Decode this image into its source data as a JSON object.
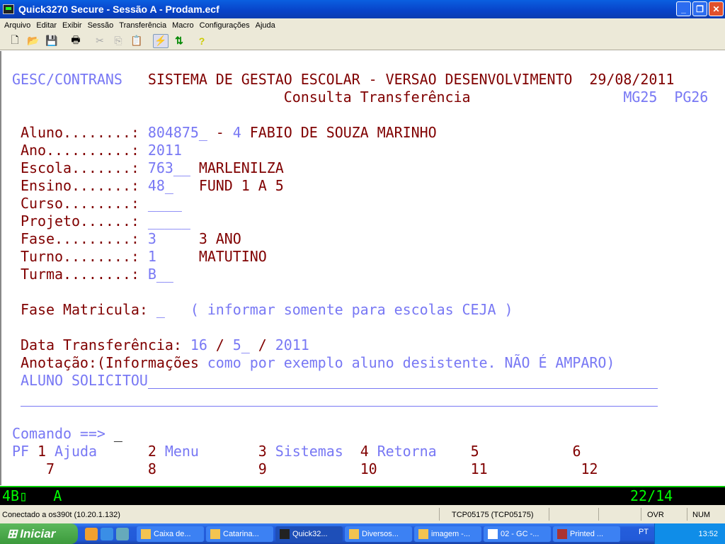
{
  "window": {
    "title": "Quick3270 Secure - Sessão A - Prodam.ecf"
  },
  "menu": [
    "Arquivo",
    "Editar",
    "Exibir",
    "Sessão",
    "Transferência",
    "Macro",
    "Configurações",
    "Ajuda"
  ],
  "toolbar": {
    "icons": [
      "new-icon",
      "open-icon",
      "save-icon",
      "print-icon",
      "cut-icon",
      "copy-icon",
      "paste-icon",
      "connect-icon",
      "transfer-icon",
      "help-icon"
    ]
  },
  "colors": {
    "field": "#7878f4",
    "label": "#800000",
    "oia": "#00ff00"
  },
  "screen": {
    "system": "GESC/CONTRANS",
    "heading": "SISTEMA DE GESTAO ESCOLAR - VERSAO DESENVOLVIMENTO",
    "date": "29/08/2011",
    "subtitle": "Consulta Transferência",
    "map": "MG25",
    "program": "PG26",
    "fields": [
      {
        "label": "Aluno........: ",
        "value": "804875_",
        "sep": " - ",
        "digit": "4",
        "desc": " FABIO DE SOUZA MARINHO"
      },
      {
        "label": "Ano..........: ",
        "value": "2011"
      },
      {
        "label": "Escola.......: ",
        "value": "763__ ",
        "desc": "MARLENILZA"
      },
      {
        "label": "Ensino.......: ",
        "value": "48_   ",
        "desc": "FUND 1 A 5"
      },
      {
        "label": "Curso........: ",
        "value": "____"
      },
      {
        "label": "Projeto......: ",
        "value": "_____"
      },
      {
        "label": "Fase.........: ",
        "value": "3     ",
        "desc": "3 ANO"
      },
      {
        "label": "Turno........: ",
        "value": "1     ",
        "desc": "MATUTINO"
      },
      {
        "label": "Turma........: ",
        "value": "B__"
      }
    ],
    "fase_matricula": {
      "label": "Fase Matricula: ",
      "value": "_",
      "hint": "   ( informar somente para escolas CEJA )"
    },
    "data_transf": {
      "label": "Data Transferência: ",
      "day": "16",
      "s1": " / ",
      "month": "5_",
      "s2": " / ",
      "year": "2011"
    },
    "anotacao": {
      "label": "Anotação:(Informações",
      "hint": " como por exemplo aluno desistente. NÃO É AMPARO)",
      "line1": "ALUNO SOLICITOU",
      "line2": ""
    },
    "command": {
      "label": "Comando ==> ",
      "value": "_"
    },
    "pf_prefix": "PF ",
    "pf": [
      {
        "key": "1",
        "label": " Ajuda"
      },
      {
        "key": "2",
        "label": " Menu"
      },
      {
        "key": "3",
        "label": " Sistemas"
      },
      {
        "key": "4",
        "label": " Retorna"
      },
      {
        "key": "5",
        "label": ""
      },
      {
        "key": "6",
        "label": ""
      },
      {
        "key": "7"
      },
      {
        "key": "8"
      },
      {
        "key": "9"
      },
      {
        "key": "10"
      },
      {
        "key": "11"
      },
      {
        "key": "12"
      }
    ]
  },
  "oia": {
    "left": "4B▯   A",
    "cursor": "22/14"
  },
  "status": {
    "connection": "Conectado a os390t (10.20.1.132)",
    "lu": "TCP05175 (TCP05175)",
    "ovr": "OVR",
    "num": "NUM"
  },
  "taskbar": {
    "start": "Iniciar",
    "tasks": [
      "Caixa de...",
      "Catarina...",
      "Quick32...",
      "Diversos...",
      "imagem -...",
      "02 - GC -...",
      "Printed ..."
    ],
    "lang": "PT",
    "clock": "13:52"
  }
}
